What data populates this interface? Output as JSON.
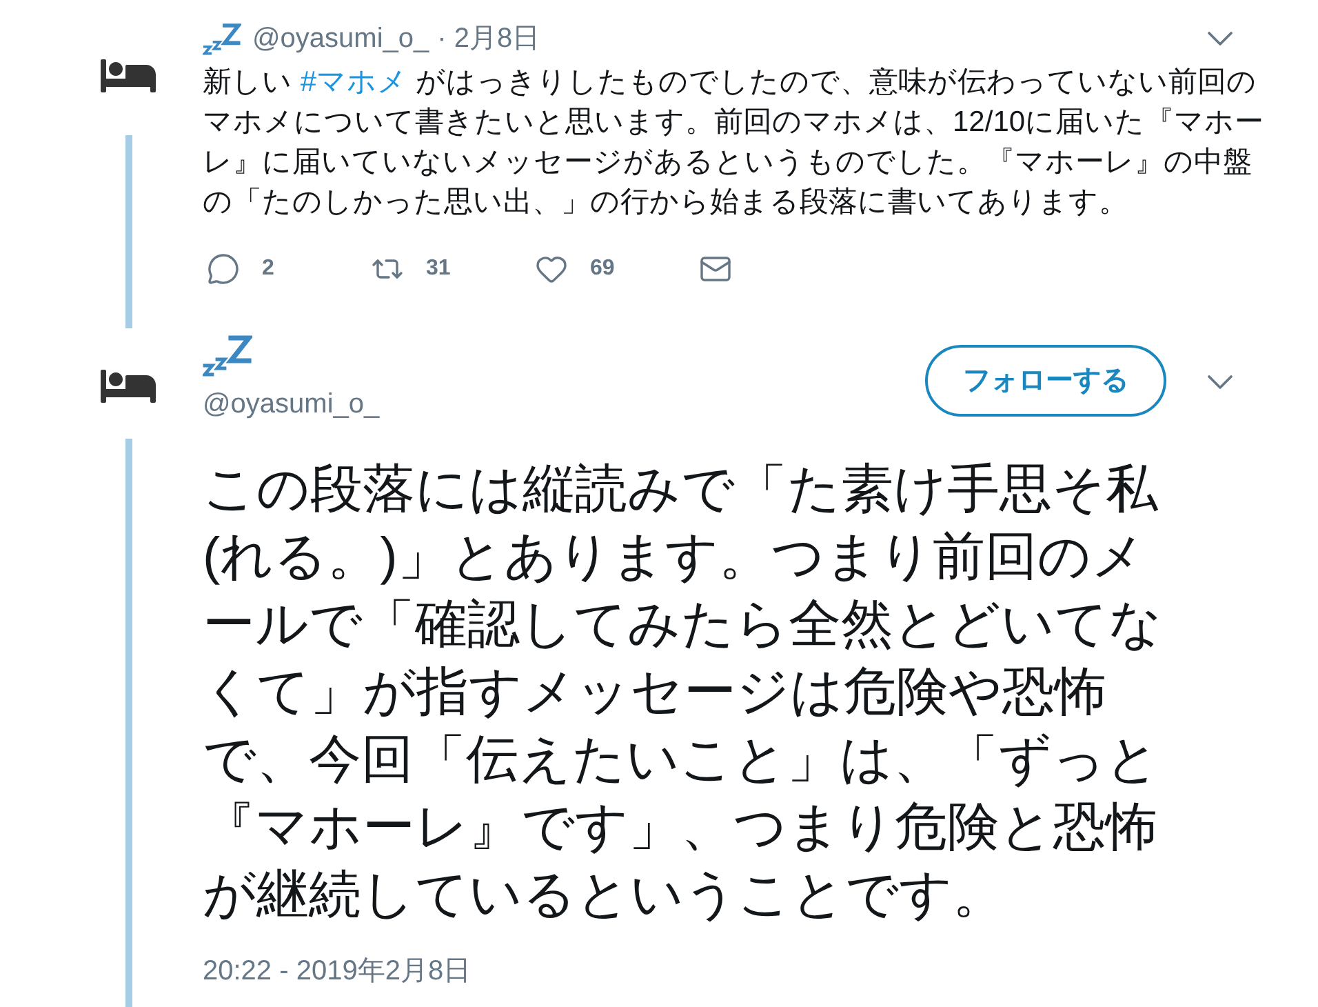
{
  "tweets": [
    {
      "kind": "compact",
      "handle": "@oyasumi_o_",
      "date": "· 2月8日",
      "text": [
        {
          "kind": "text",
          "text": "新しい "
        },
        {
          "kind": "hashtag",
          "text": "#マホメ"
        },
        {
          "kind": "text",
          "text": " がはっきりしたものでしたので、意味が伝わっていない前回のマホメについて書きたいと思います。前回のマホメは、12/10に届いた『マホーレ』に届いていないメッセージがあるというものでした。『マホーレ』の中盤の「たのしかった思い出、」の行から始まる段落に書いてあります。"
        }
      ],
      "actions": [
        {
          "kind": "reply",
          "count": "2"
        },
        {
          "kind": "retweet",
          "count": "31"
        },
        {
          "kind": "like",
          "count": "69"
        },
        {
          "kind": "message"
        }
      ]
    },
    {
      "kind": "focused",
      "handle": "@oyasumi_o_",
      "follow_button": "フォローする",
      "text": [
        {
          "kind": "text",
          "text": "この段落には縦読みで「た素け手思そ私(れる。)」とあります。つまり前回のメールで「確認してみたら全然とどいてなくて」が指すメッセージは危険や恐怖で、今回「伝えたいこと」は、「ずっと『マホーレ』です」、つまり危険と恐怖が継続しているということです。"
        }
      ],
      "timestamp": "20:22 - 2019年2月8日"
    }
  ]
}
